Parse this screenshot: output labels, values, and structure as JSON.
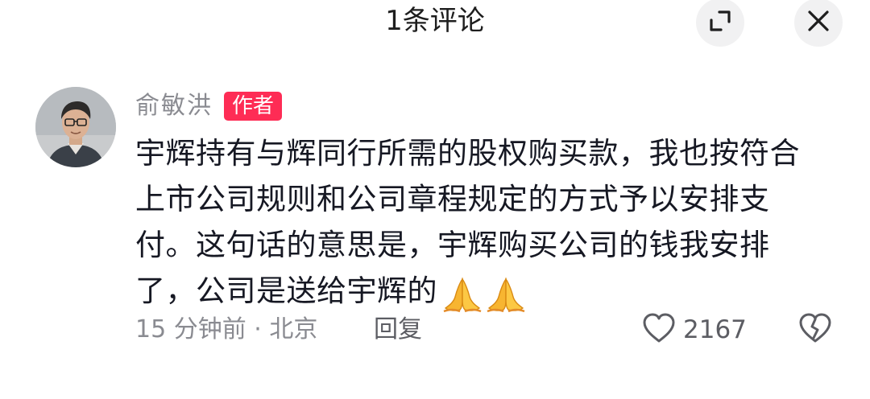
{
  "header": {
    "title": "1条评论"
  },
  "comment": {
    "author": "俞敏洪",
    "author_badge": "作者",
    "text": "宇辉持有与辉同行所需的股权购买款，我也按符合上市公司规则和公司章程规定的方式予以安排支付。这句话的意思是，宇辉购买公司的钱我安排了，公司是送给宇辉的",
    "emojis": [
      "folded-hands-icon",
      "folded-hands-icon"
    ],
    "meta_time": "15 分钟前 · 北京",
    "reply_label": "回复",
    "like_count": "2167"
  },
  "colors": {
    "badge": "#fe2c55",
    "primary_text": "#161823",
    "secondary_text": "#8a8b91",
    "button_bg": "#f1f1f2"
  }
}
